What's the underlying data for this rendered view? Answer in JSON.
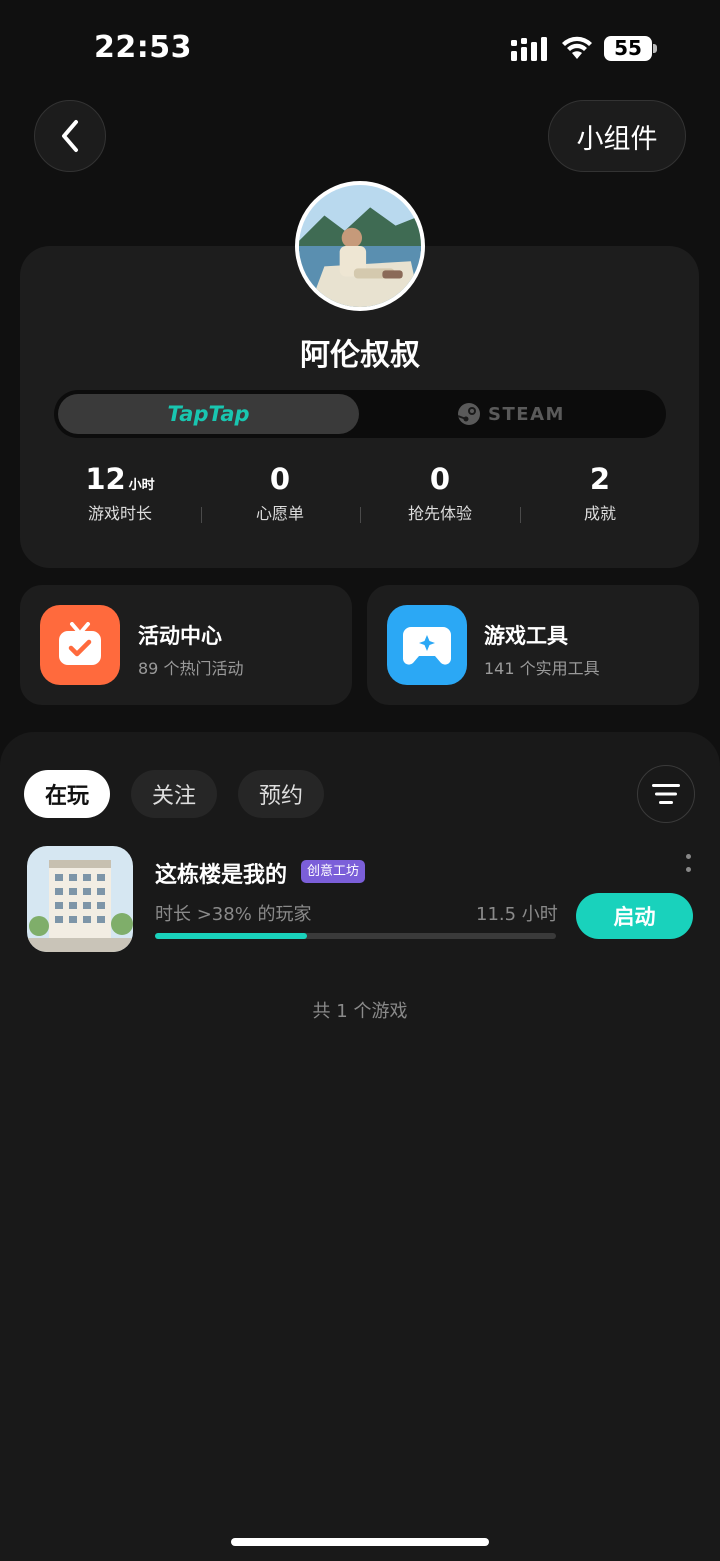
{
  "status_bar": {
    "time": "22:53",
    "battery": "55"
  },
  "header": {
    "widget_label": "小组件"
  },
  "profile": {
    "name": "阿伦叔叔",
    "platforms": [
      "TapTap",
      "STEAM"
    ],
    "stats": [
      {
        "value": "12",
        "unit": "小时",
        "label": "游戏时长"
      },
      {
        "value": "0",
        "unit": "",
        "label": "心愿单"
      },
      {
        "value": "0",
        "unit": "",
        "label": "抢先体验"
      },
      {
        "value": "2",
        "unit": "",
        "label": "成就"
      }
    ]
  },
  "quick_cards": [
    {
      "title": "活动中心",
      "subtitle": "89 个热门活动",
      "color": "#ff6a3d"
    },
    {
      "title": "游戏工具",
      "subtitle": "141 个实用工具",
      "color": "#2ba8f5"
    }
  ],
  "tabs": [
    "在玩",
    "关注",
    "预约"
  ],
  "active_tab": "在玩",
  "game": {
    "title": "这栋楼是我的",
    "badge": "创意工坊",
    "rank_text": "时长 >38% 的玩家",
    "hours_text": "11.5 小时",
    "progress": 0.38,
    "action_label": "启动"
  },
  "total_text": "共 1 个游戏",
  "colors": {
    "accent": "#19d2bc",
    "badge": "#7b5fd9"
  }
}
